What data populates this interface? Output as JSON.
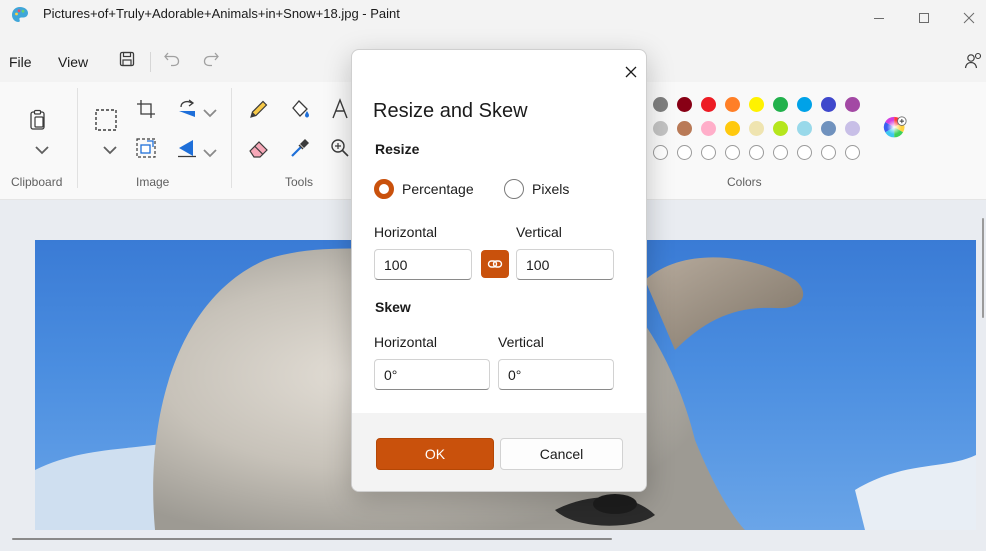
{
  "window": {
    "title": "Pictures+of+Truly+Adorable+Animals+in+Snow+18.jpg - Paint",
    "accent_color": "#c9510c"
  },
  "menu": {
    "file": "File",
    "view": "View"
  },
  "ribbon": {
    "groups": {
      "clipboard": "Clipboard",
      "image": "Image",
      "tools": "Tools",
      "colors": "Colors"
    },
    "palette": [
      [
        "#7f7f7f",
        "#880015",
        "#ed1c24",
        "#ff7f27",
        "#fff200",
        "#22b14c",
        "#00a2e8",
        "#3f48cc",
        "#a349a4"
      ],
      [
        "#c3c3c3",
        "#b97a57",
        "#ffaec9",
        "#ffc90e",
        "#efe4b0",
        "#b5e61d",
        "#99d9ea",
        "#7092be",
        "#c8bfe7"
      ],
      [
        "",
        "",
        "",
        "",
        "",
        "",
        "",
        "",
        ""
      ]
    ]
  },
  "dialog": {
    "title": "Resize and Skew",
    "resize_heading": "Resize",
    "option_percentage": "Percentage",
    "option_pixels": "Pixels",
    "selected_option": "Percentage",
    "resize_horizontal_label": "Horizontal",
    "resize_vertical_label": "Vertical",
    "resize_horizontal_value": "100",
    "resize_vertical_value": "100",
    "aspect_ratio_locked": true,
    "skew_heading": "Skew",
    "skew_horizontal_label": "Horizontal",
    "skew_vertical_label": "Vertical",
    "skew_horizontal_value": "0°",
    "skew_vertical_value": "0°",
    "ok_label": "OK",
    "cancel_label": "Cancel"
  }
}
